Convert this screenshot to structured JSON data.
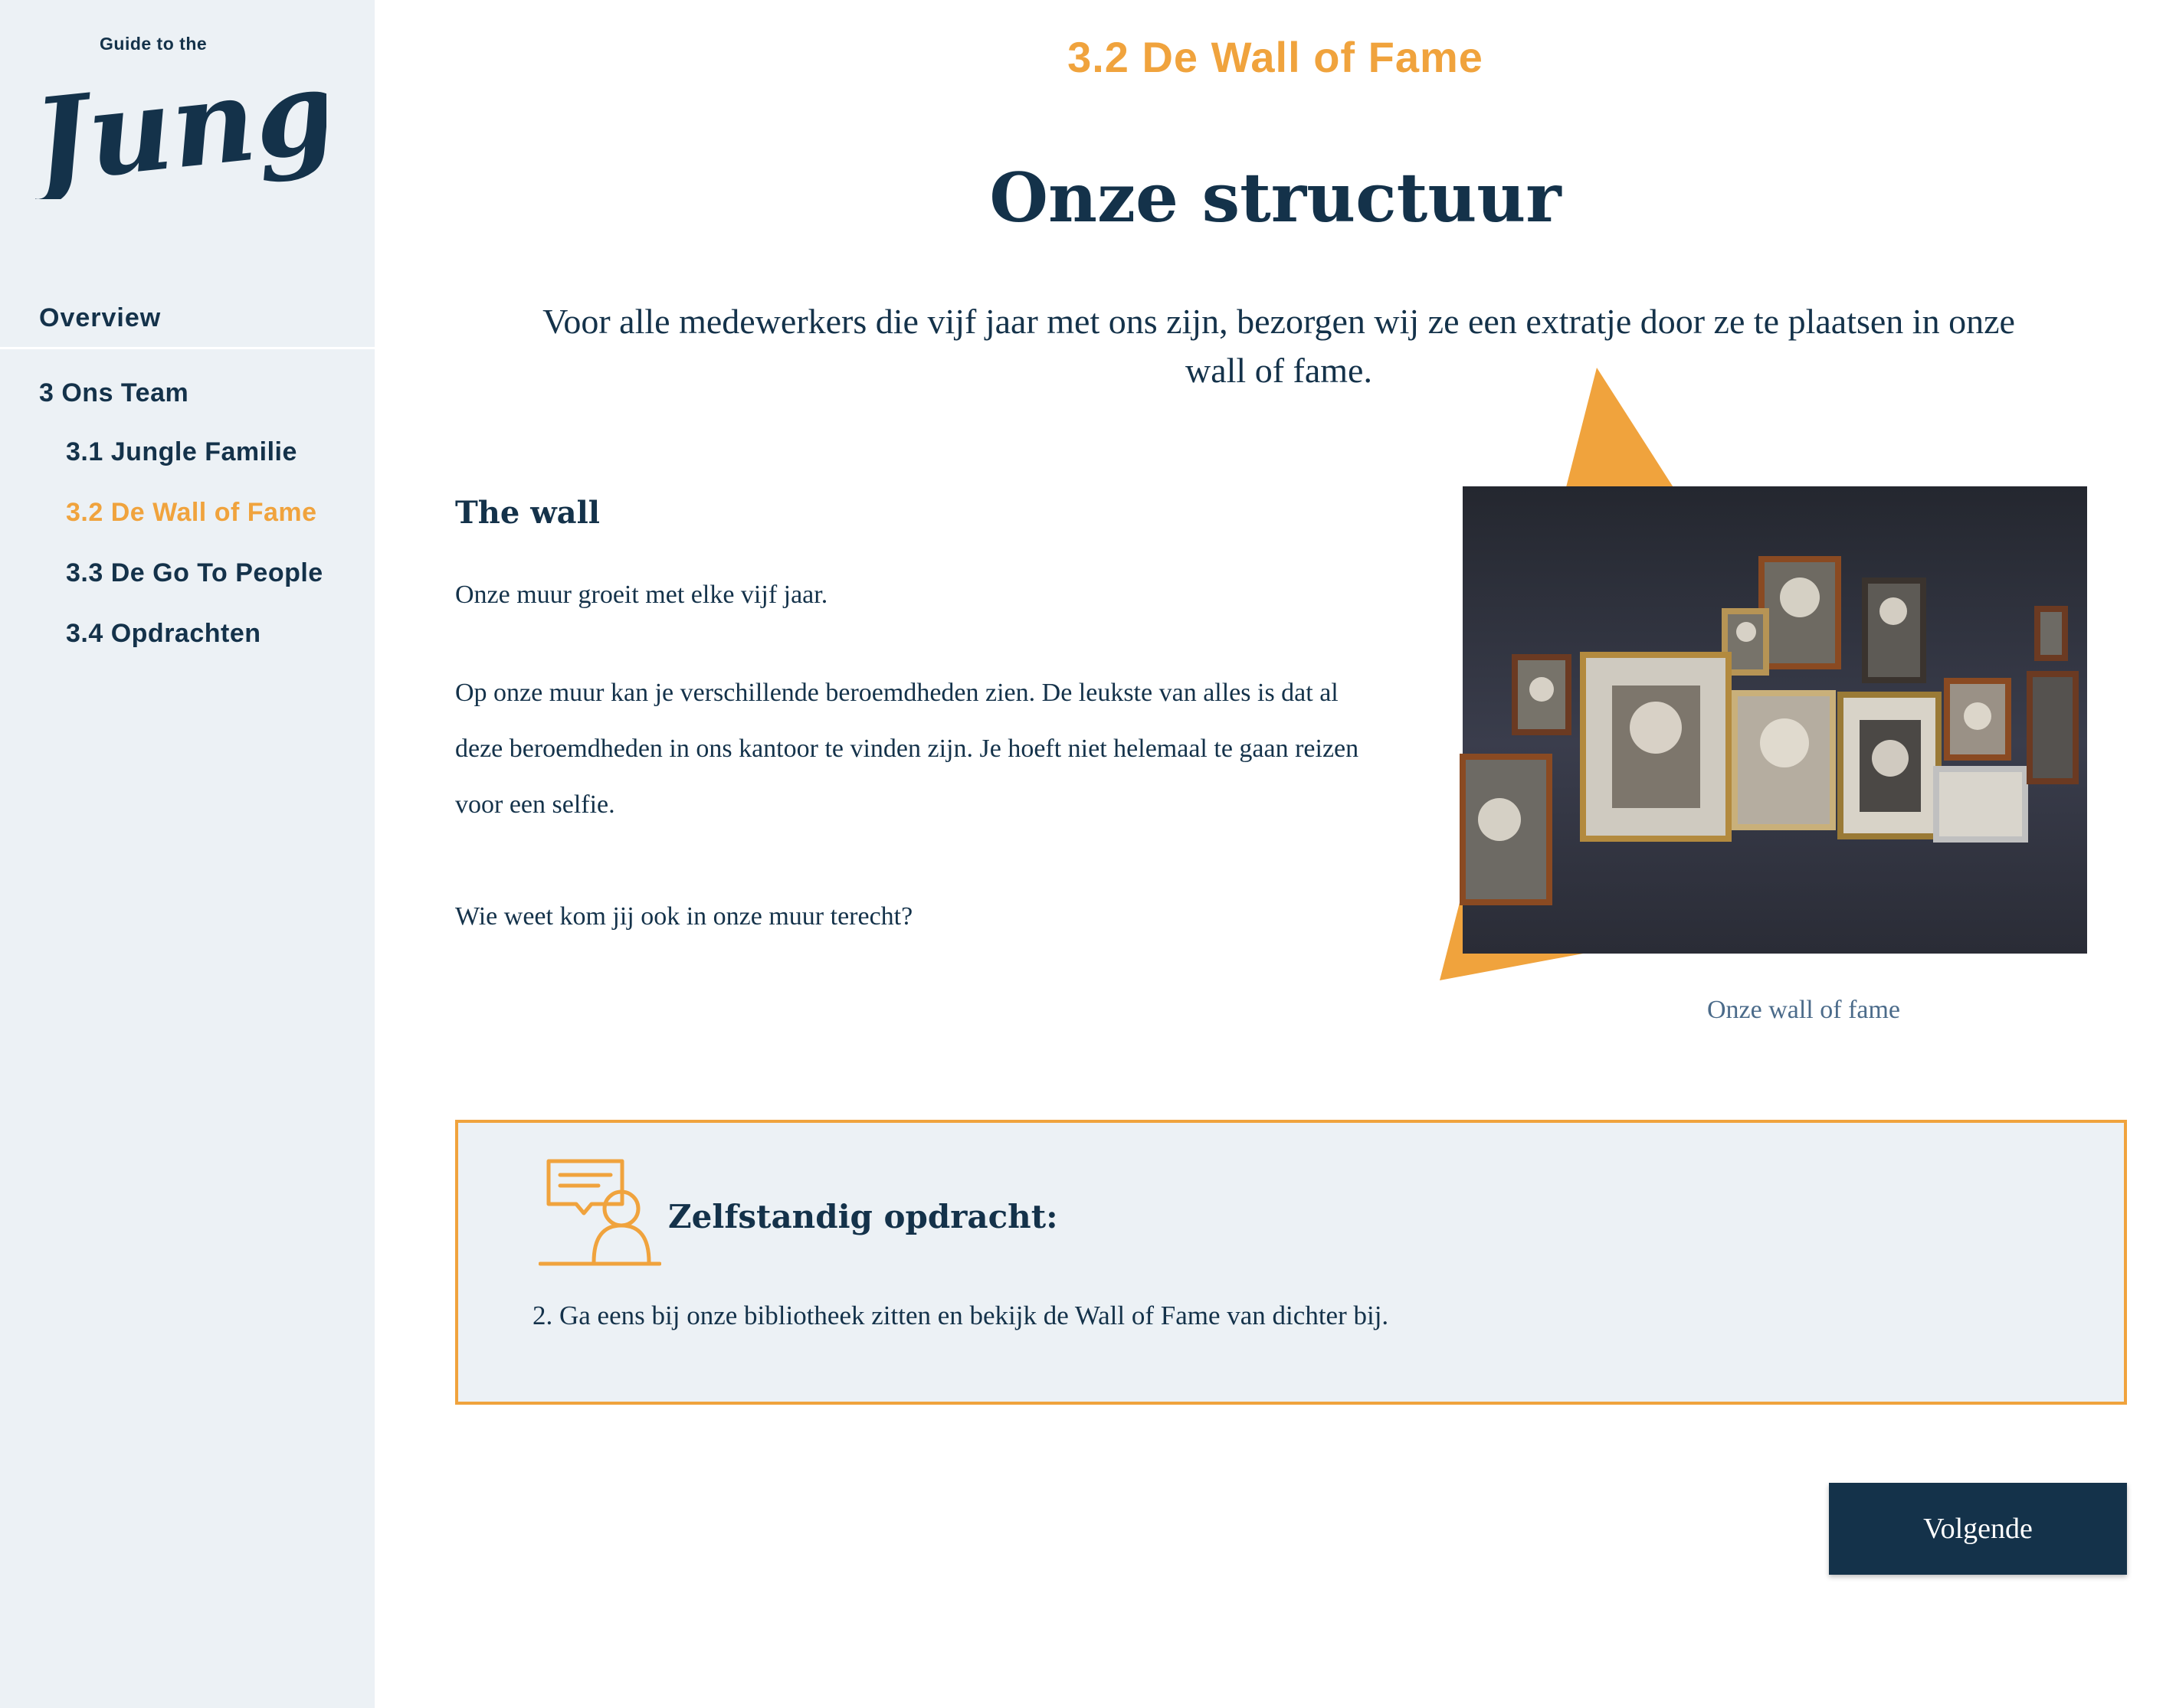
{
  "logo": {
    "small_text": "Guide to the",
    "script_text": "Jungle"
  },
  "nav": {
    "overview": "Overview",
    "section": "3 Ons Team",
    "items": [
      {
        "label": "3.1 Jungle Familie",
        "active": false
      },
      {
        "label": "3.2 De Wall of Fame",
        "active": true
      },
      {
        "label": "3.3 De Go To People",
        "active": false
      },
      {
        "label": "3.4 Opdrachten",
        "active": false
      }
    ]
  },
  "page": {
    "kicker": "3.2 De Wall of Fame",
    "title": "Onze structuur",
    "intro": "Voor alle medewerkers die vijf jaar met ons zijn, bezorgen wij ze een extratje door ze te plaatsen in onze wall of fame."
  },
  "content": {
    "heading": "The wall",
    "paragraphs": [
      "Onze muur groeit met elke vijf jaar.",
      "Op onze muur kan je verschillende beroemdheden zien. De leukste van alles is dat al deze beroemdheden in ons kantoor te vinden zijn. Je hoeft niet helemaal te gaan reizen voor een selfie.",
      "Wie weet kom jij ook in onze muur terecht?"
    ],
    "image_caption": "Onze wall of fame"
  },
  "task": {
    "heading": "Zelfstandig opdracht:",
    "text": "2. Ga eens bij onze bibliotheek zitten en bekijk de Wall of Fame van dichter bij."
  },
  "actions": {
    "next_label": "Volgende"
  },
  "colors": {
    "accent": "#f0a33d",
    "navy": "#14324a",
    "sidebar_bg": "#ecf1f5"
  }
}
